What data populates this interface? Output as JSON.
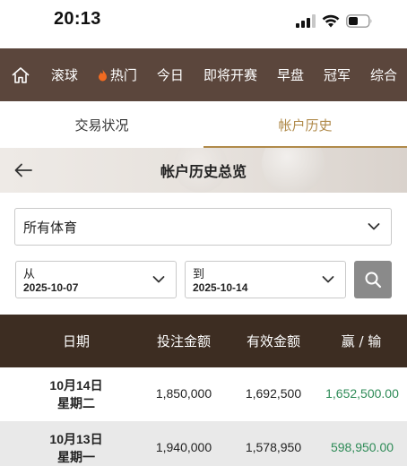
{
  "status_bar": {
    "time": "20:13"
  },
  "top_nav": {
    "items": [
      {
        "label": "滚球"
      },
      {
        "label": "热门"
      },
      {
        "label": "今日"
      },
      {
        "label": "即将开赛"
      },
      {
        "label": "早盘"
      },
      {
        "label": "冠军"
      },
      {
        "label": "综合"
      }
    ],
    "background": "#5b463c"
  },
  "tabs": [
    {
      "label": "交易状况",
      "active": false
    },
    {
      "label": "帐户历史",
      "active": true
    }
  ],
  "banner": {
    "title": "帐户历史总览"
  },
  "filters": {
    "sport": "所有体育",
    "from_label": "从",
    "from_value": "2025-10-07",
    "to_label": "到",
    "to_value": "2025-10-14"
  },
  "table": {
    "headers": [
      "日期",
      "投注金额",
      "有效金额",
      "赢 / 输"
    ],
    "rows": [
      {
        "date": "10月14日",
        "weekday": "星期二",
        "stake": "1,850,000",
        "valid": "1,692,500",
        "result": "1,652,500.00"
      },
      {
        "date": "10月13日",
        "weekday": "星期一",
        "stake": "1,940,000",
        "valid": "1,578,950",
        "result": "598,950.00"
      }
    ],
    "result_color": "#2e8b57"
  },
  "icons": {
    "home": "home-icon",
    "fire": "flame-icon",
    "back": "back-arrow-icon",
    "search": "search-icon",
    "dropdown": "chevron-down-icon"
  },
  "accent_color": "#b08a4a"
}
